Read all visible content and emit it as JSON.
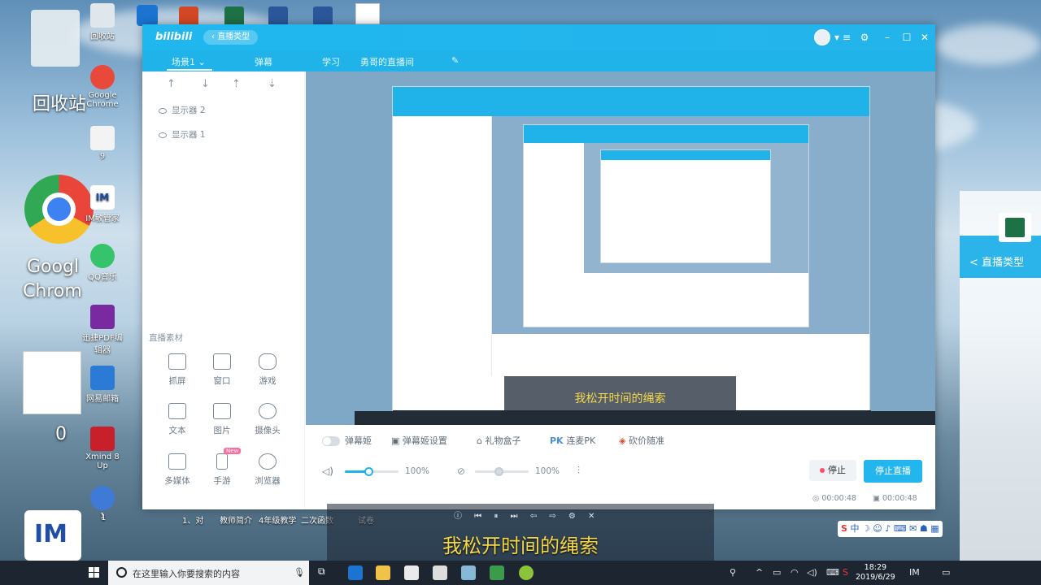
{
  "desktop": {
    "big_labels": [
      "回收站",
      "Googl",
      "Chrom",
      "0"
    ],
    "icons": [
      {
        "label": "回收站",
        "color": "#dfe7ec"
      },
      {
        "label": "Google Chrome",
        "color": "#e9493b"
      },
      {
        "label": "9",
        "color": "#f3f3f3"
      },
      {
        "label": "IM敏管家",
        "color": "#1e4fa4"
      },
      {
        "label": "QQ音乐",
        "color": "#35c36b"
      },
      {
        "label": "迅捷PDF编辑器",
        "color": "#7a2aa0"
      },
      {
        "label": "网易邮箱",
        "color": "#2b7bd6"
      },
      {
        "label": "Xmind 8 Up",
        "color": "#c8202b"
      },
      {
        "label": "1",
        "color": "#3f7bd6"
      }
    ],
    "bottom_labels": [
      "1",
      "1、对",
      "教师简介",
      "4年级教学",
      "二次函数",
      "试卷"
    ],
    "subtitle": "我松开时间的绳索",
    "side_window_label": "< 直播类型"
  },
  "window": {
    "logo": "bilibili",
    "back_label": "直播类型",
    "nav": {
      "scene": "场景1",
      "danmu": "弹幕",
      "study": "学习",
      "room": "勇哥的直播间"
    },
    "sources": [
      "显示器 2",
      "显示器 1"
    ],
    "material_title": "直播素材",
    "materials": [
      {
        "label": "抓屏",
        "icon": "crop-icon"
      },
      {
        "label": "窗口",
        "icon": "window-icon"
      },
      {
        "label": "游戏",
        "icon": "gamepad-icon"
      },
      {
        "label": "文本",
        "icon": "text-icon"
      },
      {
        "label": "图片",
        "icon": "image-icon"
      },
      {
        "label": "摄像头",
        "icon": "camera-icon"
      },
      {
        "label": "多媒体",
        "icon": "media-icon"
      },
      {
        "label": "手游",
        "icon": "phone-icon",
        "badge": "New"
      },
      {
        "label": "浏览器",
        "icon": "browser-icon"
      }
    ],
    "controls": {
      "danmu_ji": "弹幕姬",
      "danmu_ji_settings": "弹幕姬设置",
      "gift_box": "礼物盒子",
      "pk": "连麦PK",
      "huakuang": "砍价随准"
    },
    "audio": {
      "speaker_pct": "100%",
      "mic_pct": "100%",
      "speaker_level": 0.45,
      "mic_level": 0.45
    },
    "stop_label": "停止",
    "stop_live_label": "停止直播",
    "timers": [
      "00:00:48",
      "00:00:48"
    ]
  },
  "taskbar": {
    "search_placeholder": "在这里输入你要搜索的内容",
    "time": "18:29",
    "date": "2019/6/29",
    "ime": "中"
  }
}
